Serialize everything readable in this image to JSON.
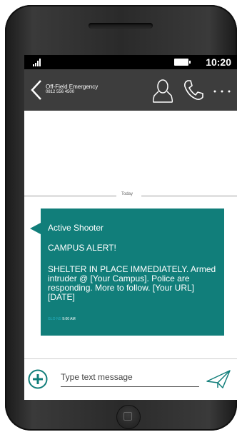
{
  "status_bar": {
    "time": "10:20"
  },
  "header": {
    "contact_name": "Off-Field Emergency",
    "contact_number": "0812 556 4500"
  },
  "thread": {
    "date_separator": "Today",
    "message": {
      "title": "Active Shooter",
      "alert": "CAMPUS ALERT!",
      "body": "SHELTER IN PLACE IMMEDIATELY. Armed intruder @ [Your Campus]. Police are responding. More to follow. [Your URL] [DATE]",
      "sender": "GLO NS",
      "time": "9:00 AM"
    }
  },
  "compose": {
    "placeholder": "Type text message"
  },
  "colors": {
    "bubble": "#117e7a",
    "header": "#3d3d3d",
    "sender_label": "#27b4c8"
  }
}
